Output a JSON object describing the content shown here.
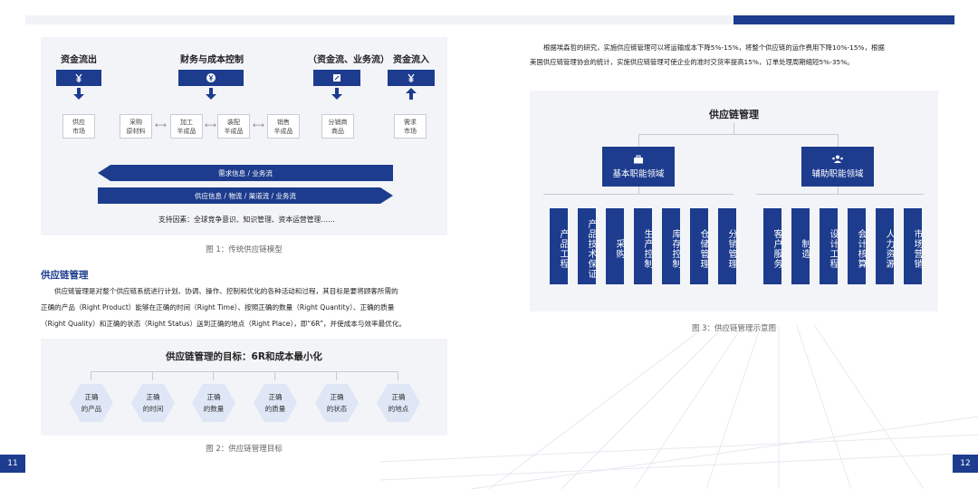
{
  "page_left": "11",
  "page_right": "12",
  "fig1": {
    "headers": [
      "资金流出",
      "财务与成本控制",
      "（资金流、业务流）",
      "资金流入"
    ],
    "boxes": {
      "supply_market": "供应\n市场",
      "purchase": "采购\n原材料",
      "process": "加工\n半成品",
      "assemble": "装配\n半成品",
      "sales": "销售\n半成品",
      "distribute": "分销商\n商品",
      "demand_market": "需求\n市场"
    },
    "arrow_left": "需求信息 / 业务流",
    "arrow_right": "供应信息 / 物流 / 渠道流 / 业务流",
    "support": "支持因素：全球竞争意识、知识管理、资本运营管理……",
    "caption": "图 1：传统供应链模型"
  },
  "section_title": "供应链管理",
  "paragraph": {
    "line1": "供应链管理是对整个供应链系统进行计划、协调、操作、控制和优化的各种活动和过程，其目标是要将顾客所需的",
    "line2": "正确的产品（Right Product）能够在正确的时间（Right Time）、按照正确的数量（Right Quantity）、正确的质量",
    "line3": "（Right Quality）和正确的状态（Right Status）送到正确的地点（Right Place），即“6R”，并使成本与效率最优化。"
  },
  "fig2": {
    "title": "供应链管理的目标：6R和成本最小化",
    "items": [
      "正确\n的产品",
      "正确\n的时间",
      "正确\n的数量",
      "正确\n的质量",
      "正确\n的状态",
      "正确\n的地点"
    ],
    "caption": "图 2：供应链管理目标"
  },
  "right_text": {
    "line1": "根据埃森哲的研究，实施供应链管理可以将运输成本下降5%-15%，将整个供应链的运作费用下降10%-15%，根据",
    "line2": "美国供应链管理协会的统计，实施供应链管理可使企业的准时交货率提高15%，订单处理周期缩短5%-35%。"
  },
  "fig3": {
    "title": "供应链管理",
    "left_head": "基本职能领域",
    "right_head": "辅助职能领域",
    "left_items": [
      "产品工程",
      "产品技术保证",
      "采购",
      "生产控制",
      "库存控制",
      "仓储管理",
      "分销管理"
    ],
    "right_items": [
      "客户服务",
      "制造",
      "设计工程",
      "会计核算",
      "人力资源",
      "市场营销"
    ],
    "caption": "图 3：供应链管理示意图"
  },
  "colors": {
    "navy": "#1d3c8e",
    "panel": "#f3f4f8",
    "hex": "#dfe6f6"
  },
  "icons": [
    "yen-down-icon",
    "yen-icon",
    "document-edit-icon",
    "yen-up-icon",
    "briefcase-icon",
    "people-icon"
  ]
}
